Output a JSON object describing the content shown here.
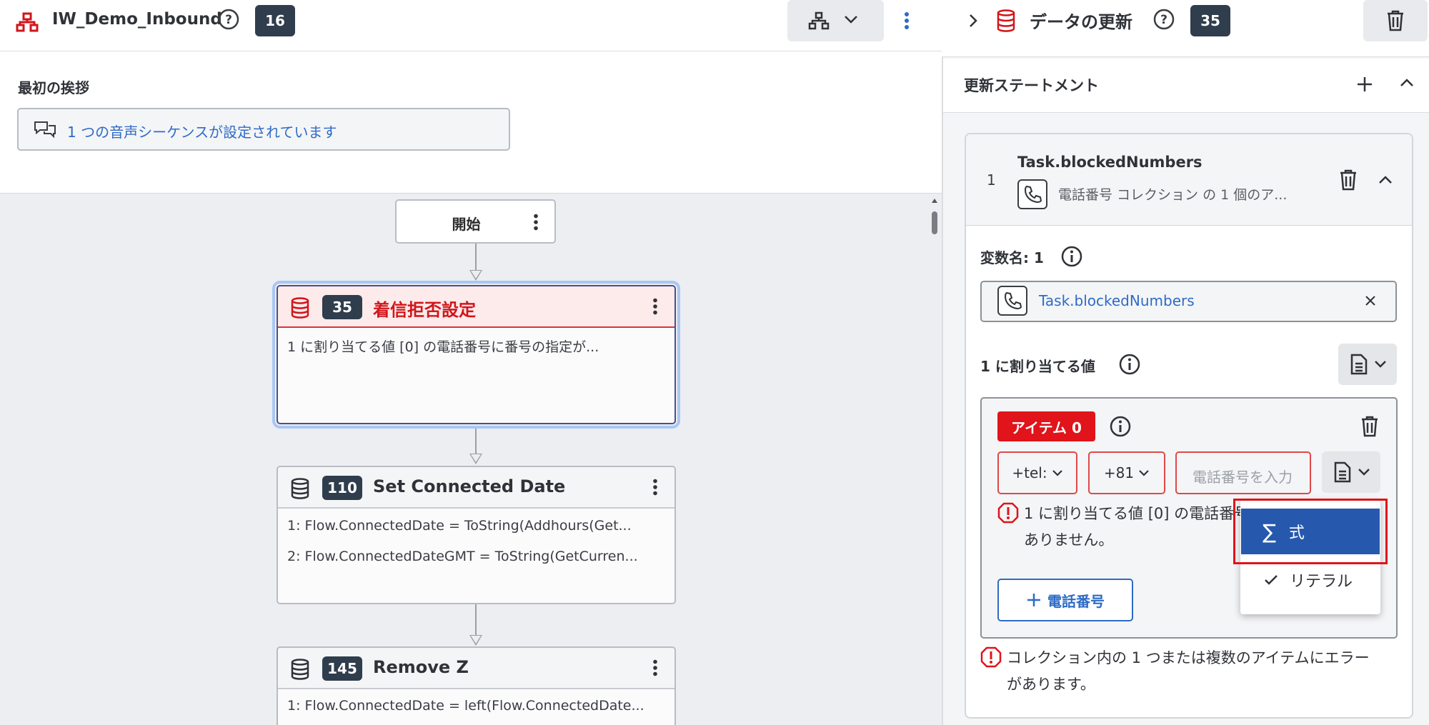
{
  "flow": {
    "name": "IW_Demo_Inbound",
    "count": "16"
  },
  "greeting": {
    "label": "最初の挨拶",
    "text": "1 つの音声シーケンスが設定されています"
  },
  "canvas": {
    "start_label": "開始",
    "nodes": [
      {
        "id": "35",
        "title": "着信拒否設定",
        "lines": [
          "1 に割り当てる値 [0] の電話番号に番号の指定が..."
        ]
      },
      {
        "id": "110",
        "title": "Set Connected Date",
        "lines": [
          "1: Flow.ConnectedDate = ToString(Addhours(Get...",
          "2: Flow.ConnectedDateGMT = ToString(GetCurren..."
        ]
      },
      {
        "id": "145",
        "title": "Remove Z",
        "lines": [
          "1: Flow.ConnectedDate = left(Flow.ConnectedDate..."
        ]
      }
    ]
  },
  "panel": {
    "title": "データの更新",
    "count": "35",
    "section_title": "更新ステートメント",
    "statement": {
      "number": "1",
      "name": "Task.blockedNumbers",
      "description": "電話番号 コレクション の 1 個のア...",
      "var_label": "変数名: 1",
      "var_value": "Task.blockedNumbers",
      "assign_label": "1 に割り当てる値",
      "item": {
        "tag": "アイテム 0",
        "scheme": "+tel:",
        "country_code": "+81",
        "phone_placeholder": "電話番号を入力",
        "error_line1": "1 に割り当てる値 [0] の電話番号",
        "error_line2": "ありません。"
      },
      "add_phone_label": "電話番号",
      "collection_error_line1": "コレクション内の 1 つまたは複数のアイテムにエラー",
      "collection_error_line2": "があります。"
    },
    "dropdown": {
      "options": [
        "式",
        "リテラル"
      ],
      "highlighted": "式",
      "checked": "リテラル"
    }
  },
  "colors": {
    "error_red": "#e0141a",
    "link_blue": "#2e6bc6",
    "selected_blue": "#2659ae",
    "badge_navy": "#2f3d4c"
  }
}
